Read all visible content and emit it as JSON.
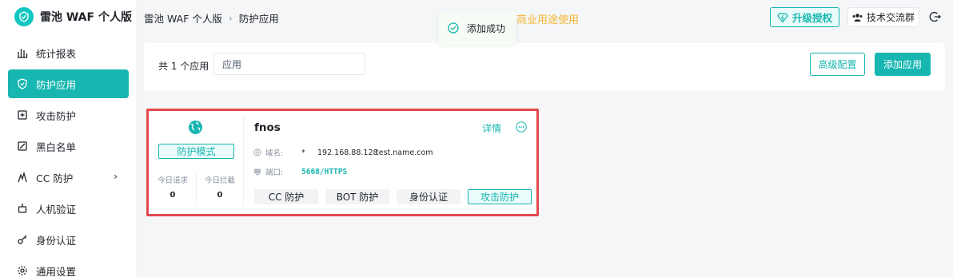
{
  "brand": {
    "name": "雷池 WAF 个人版"
  },
  "sidebar": {
    "items": [
      {
        "label": "统计报表",
        "icon": "bar-chart-icon",
        "active": false
      },
      {
        "label": "防护应用",
        "icon": "shield-icon",
        "active": true
      },
      {
        "label": "攻击防护",
        "icon": "attack-icon",
        "active": false
      },
      {
        "label": "黑白名单",
        "icon": "list-icon",
        "active": false
      },
      {
        "label": "CC 防护",
        "icon": "cc-icon",
        "active": false,
        "has_submenu": true
      },
      {
        "label": "人机验证",
        "icon": "robot-icon",
        "active": false
      },
      {
        "label": "身份认证",
        "icon": "key-icon",
        "active": false
      },
      {
        "label": "通用设置",
        "icon": "settings-icon",
        "active": false
      }
    ],
    "submenu_arrow": "›"
  },
  "header": {
    "breadcrumb": [
      "雷池 WAF 个人版",
      "防护应用"
    ],
    "breadcrumb_sep": "›",
    "notice": "商业用途使用",
    "upgrade_label": "升级授权",
    "community_label": "技术交流群"
  },
  "toast": {
    "message": "添加成功"
  },
  "toolbar": {
    "count_text": "共 1 个应用",
    "search_value": "应用",
    "advanced_label": "高级配置",
    "add_label": "添加应用"
  },
  "app_card": {
    "mode": "防护模式",
    "stats": [
      {
        "label": "今日请求",
        "value": "0"
      },
      {
        "label": "今日拦截",
        "value": "0"
      }
    ],
    "name": "fnos",
    "detail_label": "详情",
    "domain_label": "域名:",
    "domains": [
      "*",
      "192.168.88.128",
      "test.name.com"
    ],
    "port_label": "端口:",
    "port": "5668/HTTPS",
    "tags": [
      {
        "label": "CC 防护",
        "enabled": false
      },
      {
        "label": "BOT 防护",
        "enabled": false
      },
      {
        "label": "身份认证",
        "enabled": false
      },
      {
        "label": "攻击防护",
        "enabled": true
      }
    ]
  },
  "colors": {
    "accent": "#17b6b0",
    "notice": "#f2b631",
    "highlight": "#e5484d"
  }
}
